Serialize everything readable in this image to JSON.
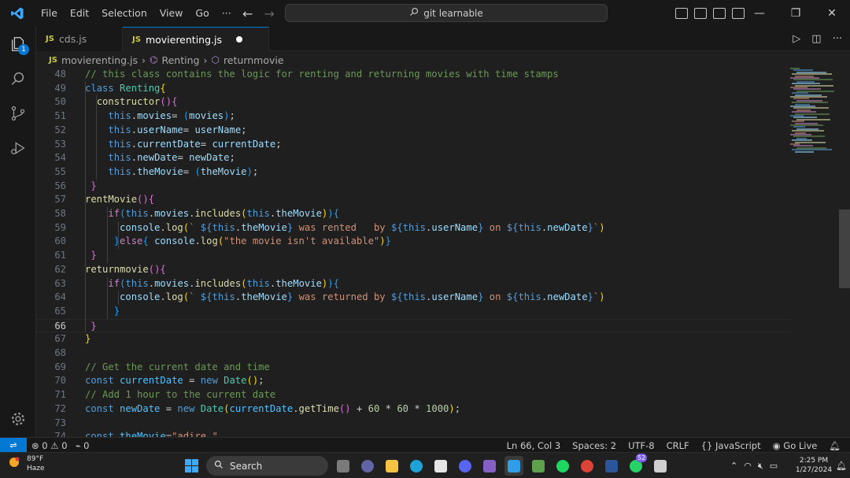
{
  "titlebar": {
    "menu": [
      "File",
      "Edit",
      "Selection",
      "View",
      "Go"
    ],
    "more": "···",
    "search_text": "git learnable"
  },
  "activity": {
    "explorer_badge": "1"
  },
  "tabs": [
    {
      "icon": "JS",
      "label": "cds.js"
    },
    {
      "icon": "JS",
      "label": "movierenting.js"
    }
  ],
  "breadcrumb": {
    "icon": "JS",
    "file": "movierenting.js",
    "cls": "Renting",
    "method": "returnmovie"
  },
  "editor": {
    "current_line": "66",
    "lines": [
      {
        "n": "48",
        "code": "// this class contains the logic for renting and returning movies with time stamps"
      },
      {
        "n": "49",
        "code": "class Renting{"
      },
      {
        "n": "50",
        "code": "  constructor(){"
      },
      {
        "n": "51",
        "code": "    this.movies= (movies);"
      },
      {
        "n": "52",
        "code": "    this.userName= userName;"
      },
      {
        "n": "53",
        "code": "    this.currentDate= currentDate;"
      },
      {
        "n": "54",
        "code": "    this.newDate= newDate;"
      },
      {
        "n": "55",
        "code": "    this.theMovie= (theMovie);"
      },
      {
        "n": "56",
        "code": " }"
      },
      {
        "n": "57",
        "code": "rentMovie(){"
      },
      {
        "n": "58",
        "code": "    if(this.movies.includes(this.theMovie)){"
      },
      {
        "n": "59",
        "code": "      console.log(` ${this.theMovie} was rented   by ${this.userName} on ${this.newDate}`)"
      },
      {
        "n": "60",
        "code": "     }else{ console.log(\"the movie isn't available\")}"
      },
      {
        "n": "61",
        "code": " }"
      },
      {
        "n": "62",
        "code": "returnmovie(){"
      },
      {
        "n": "63",
        "code": "    if(this.movies.includes(this.theMovie)){"
      },
      {
        "n": "64",
        "code": "      console.log(` ${this.theMovie} was returned by ${this.userName} on ${this.newDate}`)"
      },
      {
        "n": "65",
        "code": "     }"
      },
      {
        "n": "66",
        "code": " }"
      },
      {
        "n": "67",
        "code": "}"
      },
      {
        "n": "68",
        "code": ""
      },
      {
        "n": "69",
        "code": "// Get the current date and time"
      },
      {
        "n": "70",
        "code": "const currentDate = new Date();"
      },
      {
        "n": "71",
        "code": "// Add 1 hour to the current date"
      },
      {
        "n": "72",
        "code": "const newDate = new Date(currentDate.getTime() + 60 * 60 * 1000);"
      },
      {
        "n": "73",
        "code": ""
      },
      {
        "n": "74",
        "code": "const theMovie=\"adire \""
      }
    ]
  },
  "statusbar": {
    "errors": "0",
    "warnings": "0",
    "ports": "0",
    "position": "Ln 66, Col 3",
    "spaces": "Spaces: 2",
    "encoding": "UTF-8",
    "eol": "CRLF",
    "language": "JavaScript",
    "golive": "Go Live"
  },
  "taskbar": {
    "weather_temp": "89°F",
    "weather_desc": "Haze",
    "search": "Search",
    "whatsapp_badge": "52",
    "time": "2:25 PM",
    "date": "1/27/2024"
  },
  "colors": {
    "accent": "#0078d4",
    "editor_bg": "#1f1f1f",
    "js_icon": "#cbcb41"
  }
}
